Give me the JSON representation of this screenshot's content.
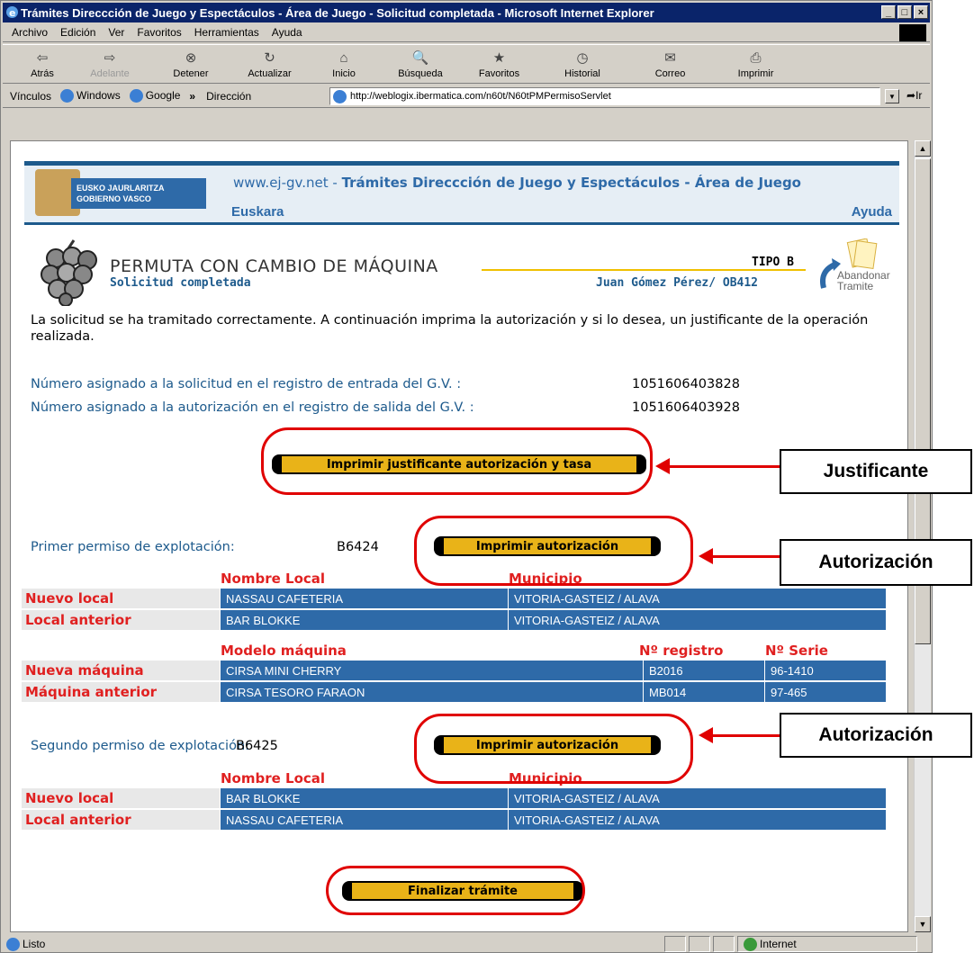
{
  "window": {
    "title": "Trámites Direccción de Juego y Espectáculos - Área de Juego - Solicitud completada - Microsoft Internet Explorer",
    "min": "_",
    "max": "□",
    "close": "×"
  },
  "menu": [
    "Archivo",
    "Edición",
    "Ver",
    "Favoritos",
    "Herramientas",
    "Ayuda"
  ],
  "toolbar": [
    {
      "label": "Atrás",
      "icon": "⇦"
    },
    {
      "label": "Adelante",
      "icon": "⇨"
    },
    {
      "label": "Detener",
      "icon": "⊗"
    },
    {
      "label": "Actualizar",
      "icon": "↻"
    },
    {
      "label": "Inicio",
      "icon": "⌂"
    },
    {
      "label": "Búsqueda",
      "icon": "🔍"
    },
    {
      "label": "Favoritos",
      "icon": "★"
    },
    {
      "label": "Historial",
      "icon": "◷"
    },
    {
      "label": "Correo",
      "icon": "✉"
    },
    {
      "label": "Imprimir",
      "icon": "⎙"
    }
  ],
  "links": {
    "label": "Vínculos",
    "items": [
      "Windows",
      "Google"
    ],
    "more": "»"
  },
  "address": {
    "label": "Dirección",
    "url": "http://weblogix.ibermatica.com/n60t/N60tPMPermisoServlet",
    "go": "Ir"
  },
  "status": {
    "text": "Listo",
    "zone": "Internet"
  },
  "header": {
    "logo_line1": "EUSKO JAURLARITZA",
    "logo_line2": "GOBIERNO VASCO",
    "site": "www.ej-gv.net - ",
    "title": "Trámites Direccción de Juego y Espectáculos - Área de Juego",
    "euskara": "Euskara",
    "ayuda": "Ayuda"
  },
  "procedure": {
    "title": "PERMUTA CON CAMBIO DE MÁQUINA",
    "subtitle": "Solicitud completada",
    "tipo": "TIPO B",
    "user": "Juan Gómez Pérez/ OB412",
    "abandon_line1": "Abandonar",
    "abandon_line2": "Tramite"
  },
  "message": "La solicitud se ha tramitado correctamente. A continuación imprima la autorización y si lo desea, un justificante de la operación realizada.",
  "registry": {
    "entry_label": "Número asignado a la solicitud en el registro de entrada del G.V. :",
    "entry_value": "1051606403828",
    "exit_label": "Número asignado a la autorización en el registro de salida del G.V. :",
    "exit_value": "1051606403928"
  },
  "buttons": {
    "justificante": "Imprimir justificante autorización y tasa",
    "autorizacion1": "Imprimir autorización",
    "autorizacion2": "Imprimir autorización",
    "finalizar": "Finalizar trámite"
  },
  "permit1": {
    "label": "Primer permiso de explotación:",
    "value": "B6424",
    "local_headers": [
      "Nombre Local",
      "Municipio"
    ],
    "locals": [
      {
        "label": "Nuevo local",
        "name": "NASSAU CAFETERIA",
        "municipio": "VITORIA-GASTEIZ / ALAVA"
      },
      {
        "label": "Local anterior",
        "name": "BAR BLOKKE",
        "municipio": "VITORIA-GASTEIZ / ALAVA"
      }
    ],
    "machine_headers": [
      "Modelo máquina",
      "Nº registro",
      "Nº Serie"
    ],
    "machines": [
      {
        "label": "Nueva máquina",
        "model": "CIRSA MINI CHERRY",
        "registro": "B2016",
        "serie": "96-1410"
      },
      {
        "label": "Máquina anterior",
        "model": "CIRSA TESORO FARAON",
        "registro": "MB014",
        "serie": "97-465"
      }
    ]
  },
  "permit2": {
    "label": "Segundo permiso de explotación:",
    "value": "B6425",
    "local_headers": [
      "Nombre Local",
      "Municipio"
    ],
    "locals": [
      {
        "label": "Nuevo local",
        "name": "BAR BLOKKE",
        "municipio": "VITORIA-GASTEIZ / ALAVA"
      },
      {
        "label": "Local anterior",
        "name": "NASSAU CAFETERIA",
        "municipio": "VITORIA-GASTEIZ / ALAVA"
      }
    ]
  },
  "callouts": {
    "justificante": "Justificante",
    "autorizacion1": "Autorización",
    "autorizacion2": "Autorización"
  },
  "colors": {
    "accent": "#2e6aa8",
    "button": "#e9b318",
    "label": "#e02020",
    "annotation": "#e00000"
  }
}
